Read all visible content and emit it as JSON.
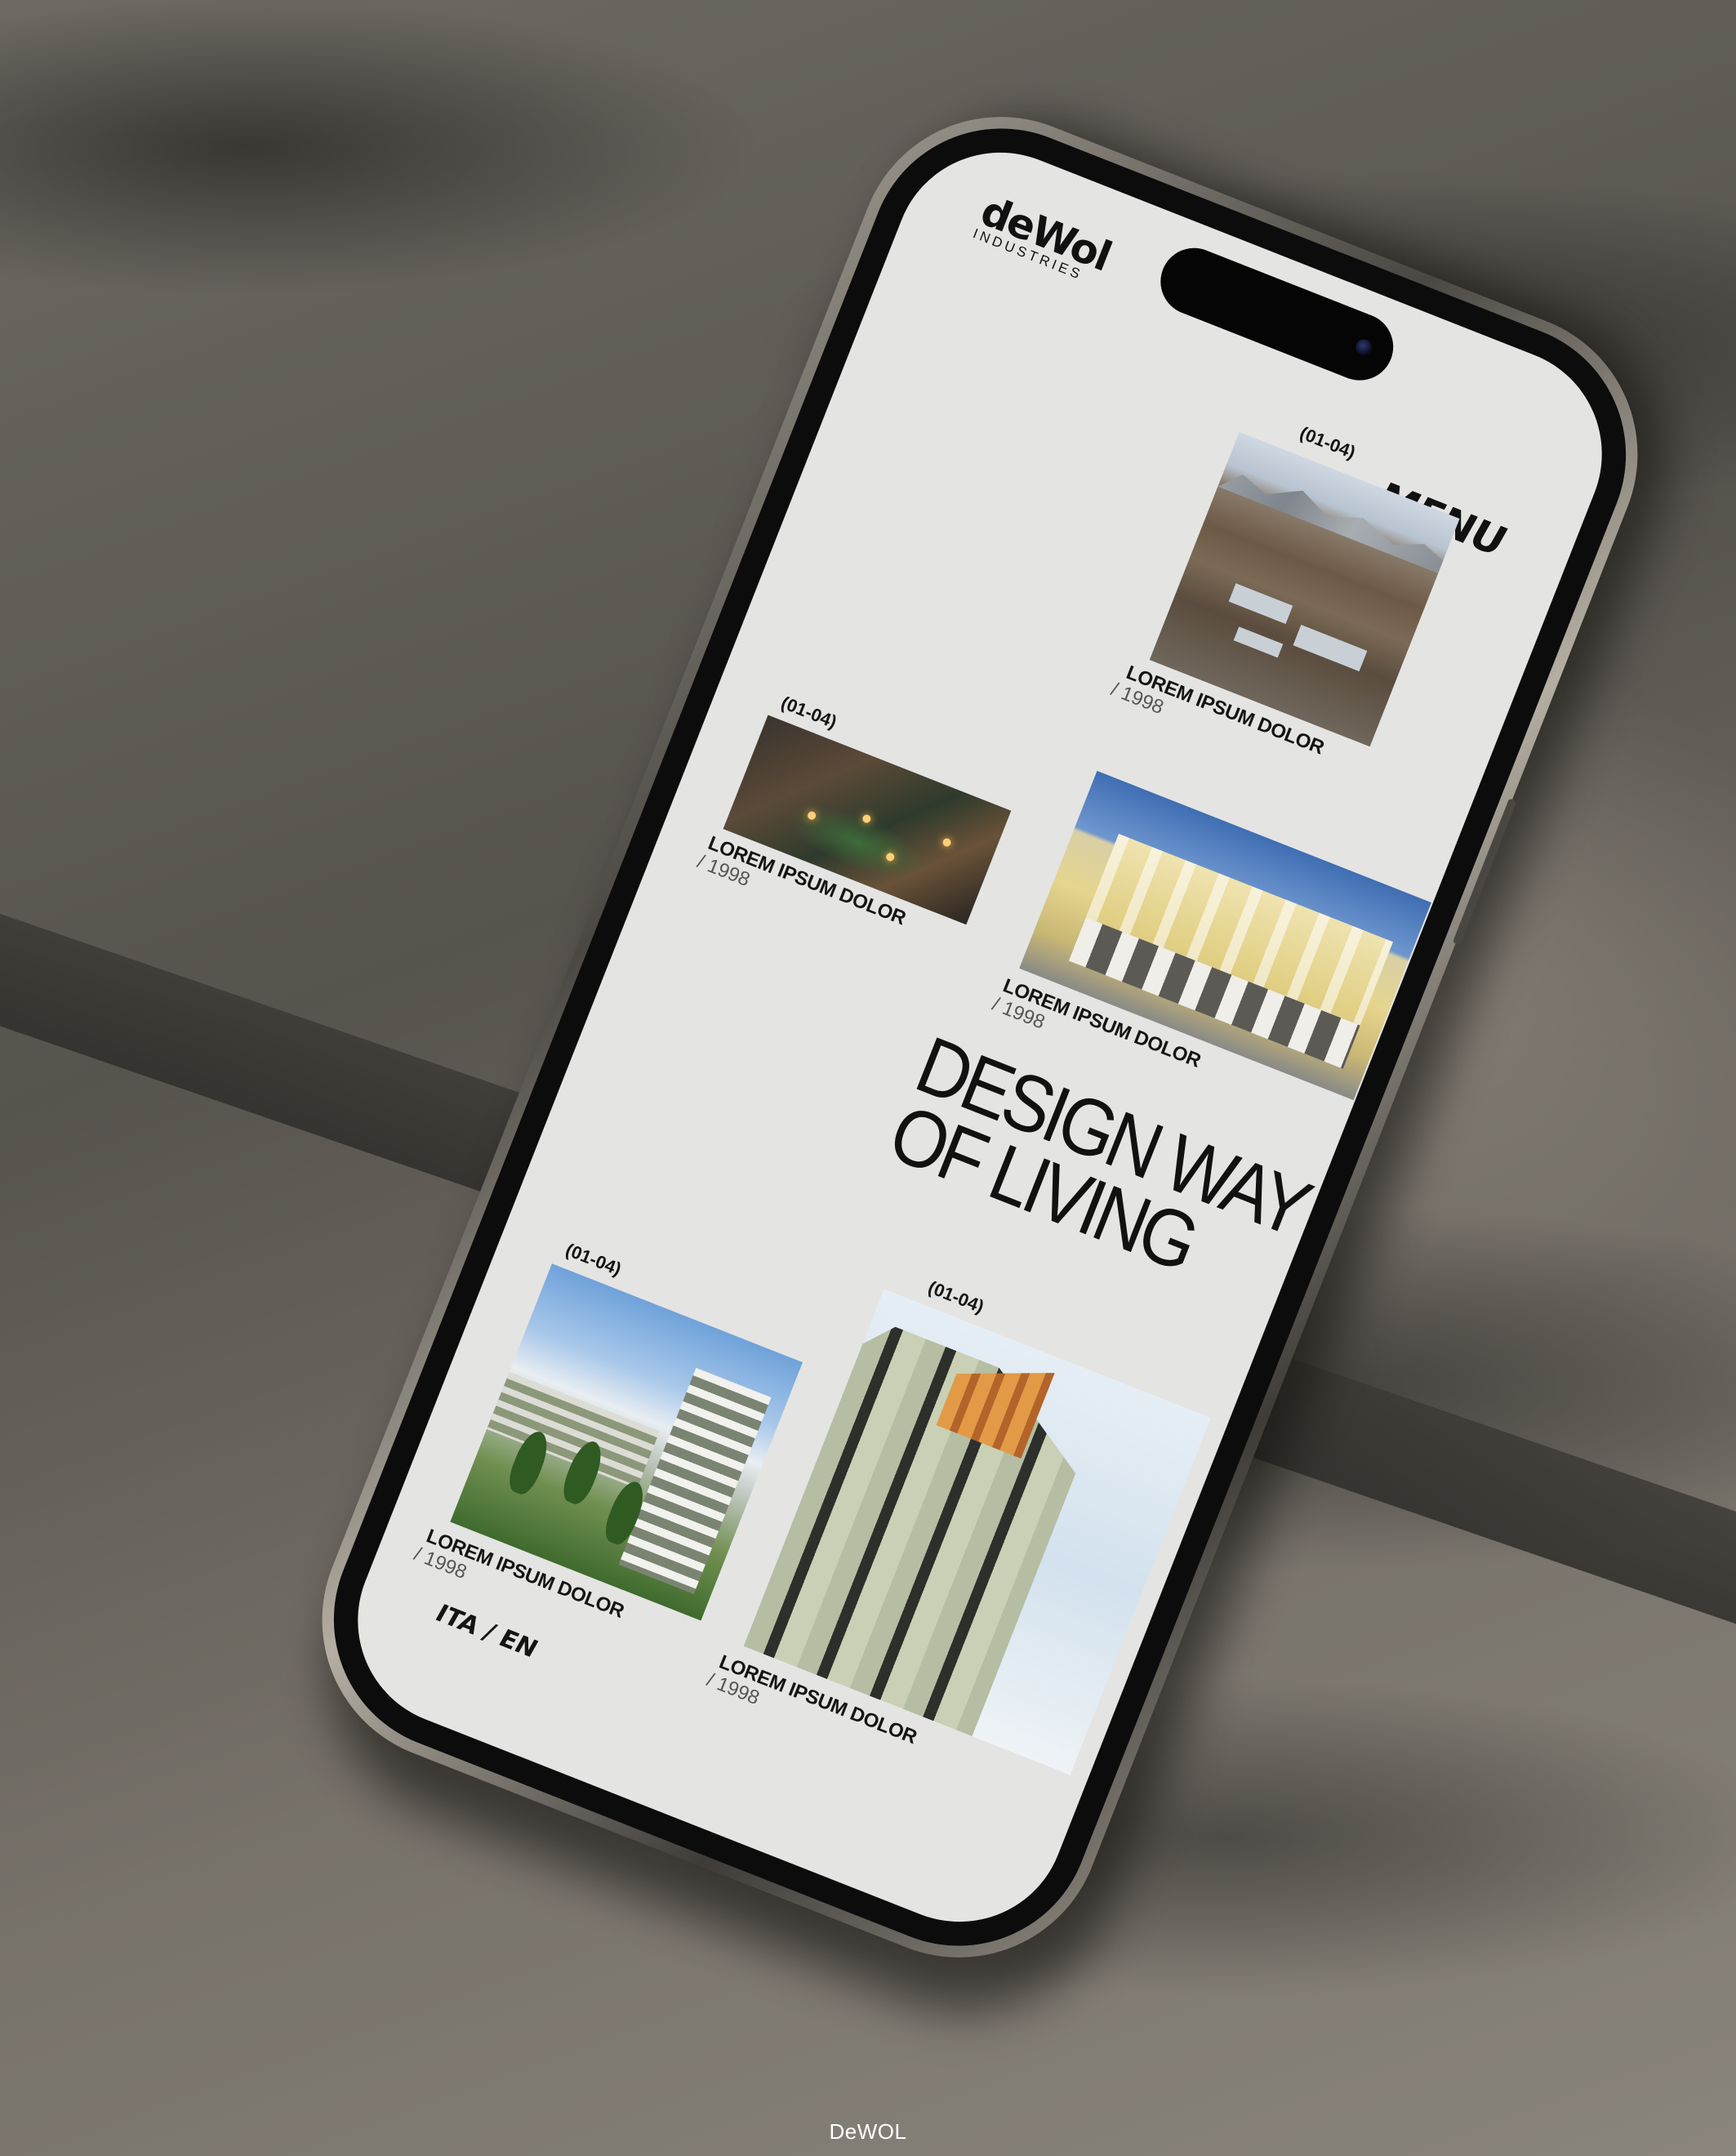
{
  "brand": {
    "logo_word": "deWol",
    "logo_sub": "INDUSTRIES"
  },
  "header": {
    "menu_label": "MENU"
  },
  "projects": [
    {
      "count": "(01-04)",
      "title": "LOREM IPSUM DOLOR",
      "year": "/ 1998",
      "image": "aerial-industrial-town"
    },
    {
      "count": "(01-04)",
      "title": "LOREM IPSUM DOLOR",
      "year": "/ 1998",
      "image": "night-courtyard"
    },
    {
      "title": "LOREM IPSUM DOLOR",
      "year": "/ 1998",
      "image": "historic-yellow-palace"
    },
    {
      "count": "(01-04)",
      "title": "LOREM IPSUM DOLOR",
      "year": "/ 1998",
      "image": "residential-tower-garden"
    },
    {
      "count": "(01-04)",
      "title": "LOREM IPSUM DOLOR",
      "year": "/ 1998",
      "image": "modern-tower-facade"
    }
  ],
  "hero": {
    "line1": "DESIGN WAY",
    "line2": "OF LIVING"
  },
  "language": {
    "ita": "ITA",
    "separator": "/",
    "en": "EN"
  },
  "watermark": "DeWOL",
  "colors": {
    "screen_bg": "#e4e4e3",
    "text": "#111111"
  }
}
